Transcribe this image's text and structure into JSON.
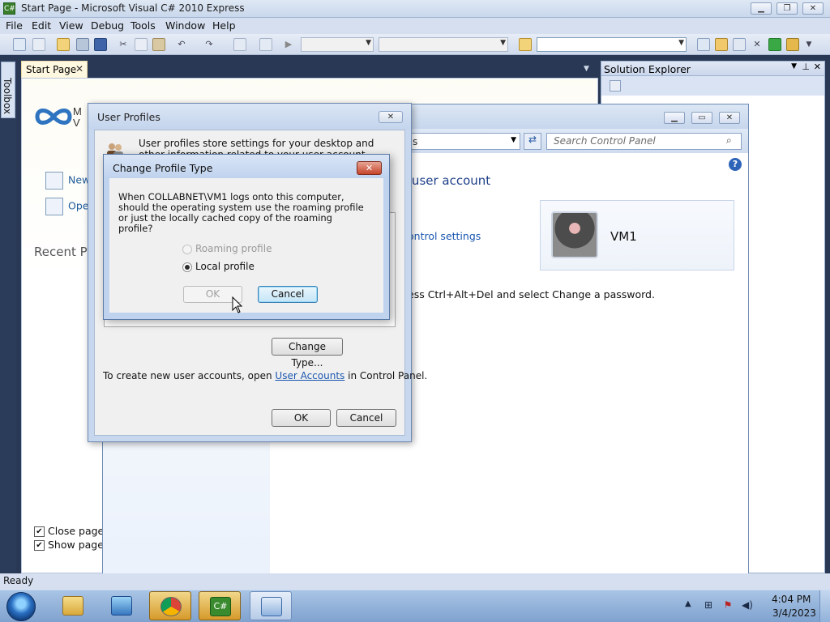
{
  "window": {
    "title": "Start Page - Microsoft Visual C# 2010 Express",
    "app_icon": "C#"
  },
  "menu": [
    "File",
    "Edit",
    "View",
    "Debug",
    "Tools",
    "Window",
    "Help"
  ],
  "toolbox": {
    "label": "Toolbox"
  },
  "start_page": {
    "tab_label": "Start Page",
    "links": [
      "New",
      "Ope"
    ],
    "recent_heading": "Recent Pr",
    "checks": [
      {
        "label": "Close page a",
        "checked": true
      },
      {
        "label": "Show page o",
        "checked": true
      }
    ]
  },
  "solution_explorer": {
    "title": "Solution Explorer"
  },
  "control_panel": {
    "address_fragment": "s",
    "search_placeholder": "Search Control Panel",
    "heading": "r user account",
    "link_settings": "ontrol settings",
    "password_text": "ess Ctrl+Alt+Del and select Change a password.",
    "user_name": "VM1"
  },
  "user_profiles": {
    "title": "User Profiles",
    "description": "User profiles store settings for your desktop and other information related to your user account. You can create a",
    "change_type_label": "Change Type...",
    "footer_prefix": "To create new user accounts, open ",
    "footer_link": "User Accounts",
    "footer_suffix": " in Control Panel.",
    "ok_label": "OK",
    "cancel_label": "Cancel"
  },
  "change_profile_type": {
    "title": "Change Profile Type",
    "question": "When COLLABNET\\VM1 logs onto this computer, should the operating system use the roaming profile or just the locally cached copy of the roaming profile?",
    "options": [
      {
        "label": "Roaming profile",
        "selected": false,
        "enabled": false
      },
      {
        "label": "Local profile",
        "selected": true,
        "enabled": true
      }
    ],
    "ok_label": "OK",
    "cancel_label": "Cancel"
  },
  "status": {
    "text": "Ready"
  },
  "taskbar": {
    "clock_time": "4:04 PM",
    "clock_date": "3/4/2023",
    "apps": [
      "explorer-icon",
      "media-player-icon",
      "chrome-icon",
      "visual-csharp-icon",
      "control-panel-icon"
    ]
  },
  "colors": {
    "accent": "#1e3f8a",
    "link": "#1a56b0",
    "taskbar": "#7fa2cf"
  }
}
